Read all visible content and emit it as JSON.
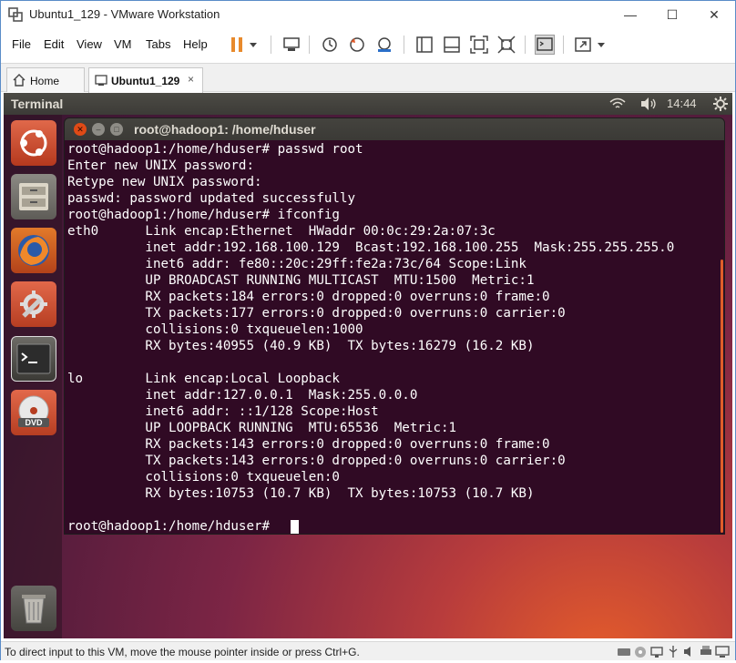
{
  "window": {
    "title": "Ubuntu1_129 - VMware Workstation",
    "icon": "vmware-icon"
  },
  "menubar": {
    "items": [
      "File",
      "Edit",
      "View",
      "VM",
      "Tabs",
      "Help"
    ]
  },
  "toolbar": {
    "icons": [
      "pause-icon",
      "dropdown-icon",
      "send-ctrl-alt-del-icon",
      "snapshot-icon",
      "revert-snapshot-icon",
      "snapshot-manager-icon",
      "console-view-icon",
      "split-view-icon",
      "fullscreen-icon",
      "unity-icon",
      "terminal-icon",
      "stretch-icon"
    ]
  },
  "tabs": [
    {
      "label": "Home",
      "icon": "home-icon",
      "active": false
    },
    {
      "label": "Ubuntu1_129",
      "icon": "vm-icon",
      "active": true,
      "close": "×"
    }
  ],
  "ubuntu_panel": {
    "app_title": "Terminal",
    "clock": "14:44",
    "icons": [
      "wifi-icon",
      "volume-icon",
      "settings-gear-icon"
    ]
  },
  "launcher": {
    "items": [
      "ubuntu-dash-icon",
      "files-icon",
      "firefox-icon",
      "system-settings-icon",
      "terminal-icon",
      "dvd-icon",
      "trash-icon"
    ]
  },
  "terminal": {
    "title": "root@hadoop1: /home/hduser",
    "lines": [
      "root@hadoop1:/home/hduser# passwd root",
      "Enter new UNIX password:",
      "Retype new UNIX password:",
      "passwd: password updated successfully",
      "root@hadoop1:/home/hduser# ifconfig",
      "eth0      Link encap:Ethernet  HWaddr 00:0c:29:2a:07:3c",
      "          inet addr:192.168.100.129  Bcast:192.168.100.255  Mask:255.255.255.0",
      "          inet6 addr: fe80::20c:29ff:fe2a:73c/64 Scope:Link",
      "          UP BROADCAST RUNNING MULTICAST  MTU:1500  Metric:1",
      "          RX packets:184 errors:0 dropped:0 overruns:0 frame:0",
      "          TX packets:177 errors:0 dropped:0 overruns:0 carrier:0",
      "          collisions:0 txqueuelen:1000",
      "          RX bytes:40955 (40.9 KB)  TX bytes:16279 (16.2 KB)",
      "",
      "lo        Link encap:Local Loopback",
      "          inet addr:127.0.0.1  Mask:255.0.0.0",
      "          inet6 addr: ::1/128 Scope:Host",
      "          UP LOOPBACK RUNNING  MTU:65536  Metric:1",
      "          RX packets:143 errors:0 dropped:0 overruns:0 frame:0",
      "          TX packets:143 errors:0 dropped:0 overruns:0 carrier:0",
      "          collisions:0 txqueuelen:0",
      "          RX bytes:10753 (10.7 KB)  TX bytes:10753 (10.7 KB)",
      "",
      "root@hadoop1:/home/hduser# "
    ]
  },
  "statusbar": {
    "text": "To direct input to this VM, move the mouse pointer inside or press Ctrl+G.",
    "icons": [
      "hdd-icon",
      "cdrom-icon",
      "network-icon",
      "usb-icon",
      "sound-icon",
      "printer-icon",
      "display-icon"
    ]
  },
  "colors": {
    "terminal_bg": "#300a24",
    "terminal_fg": "#ffffff",
    "panel_bg": "#3c3b37",
    "close_button": "#df4a16",
    "scroll_accent": "#e05e2a"
  }
}
